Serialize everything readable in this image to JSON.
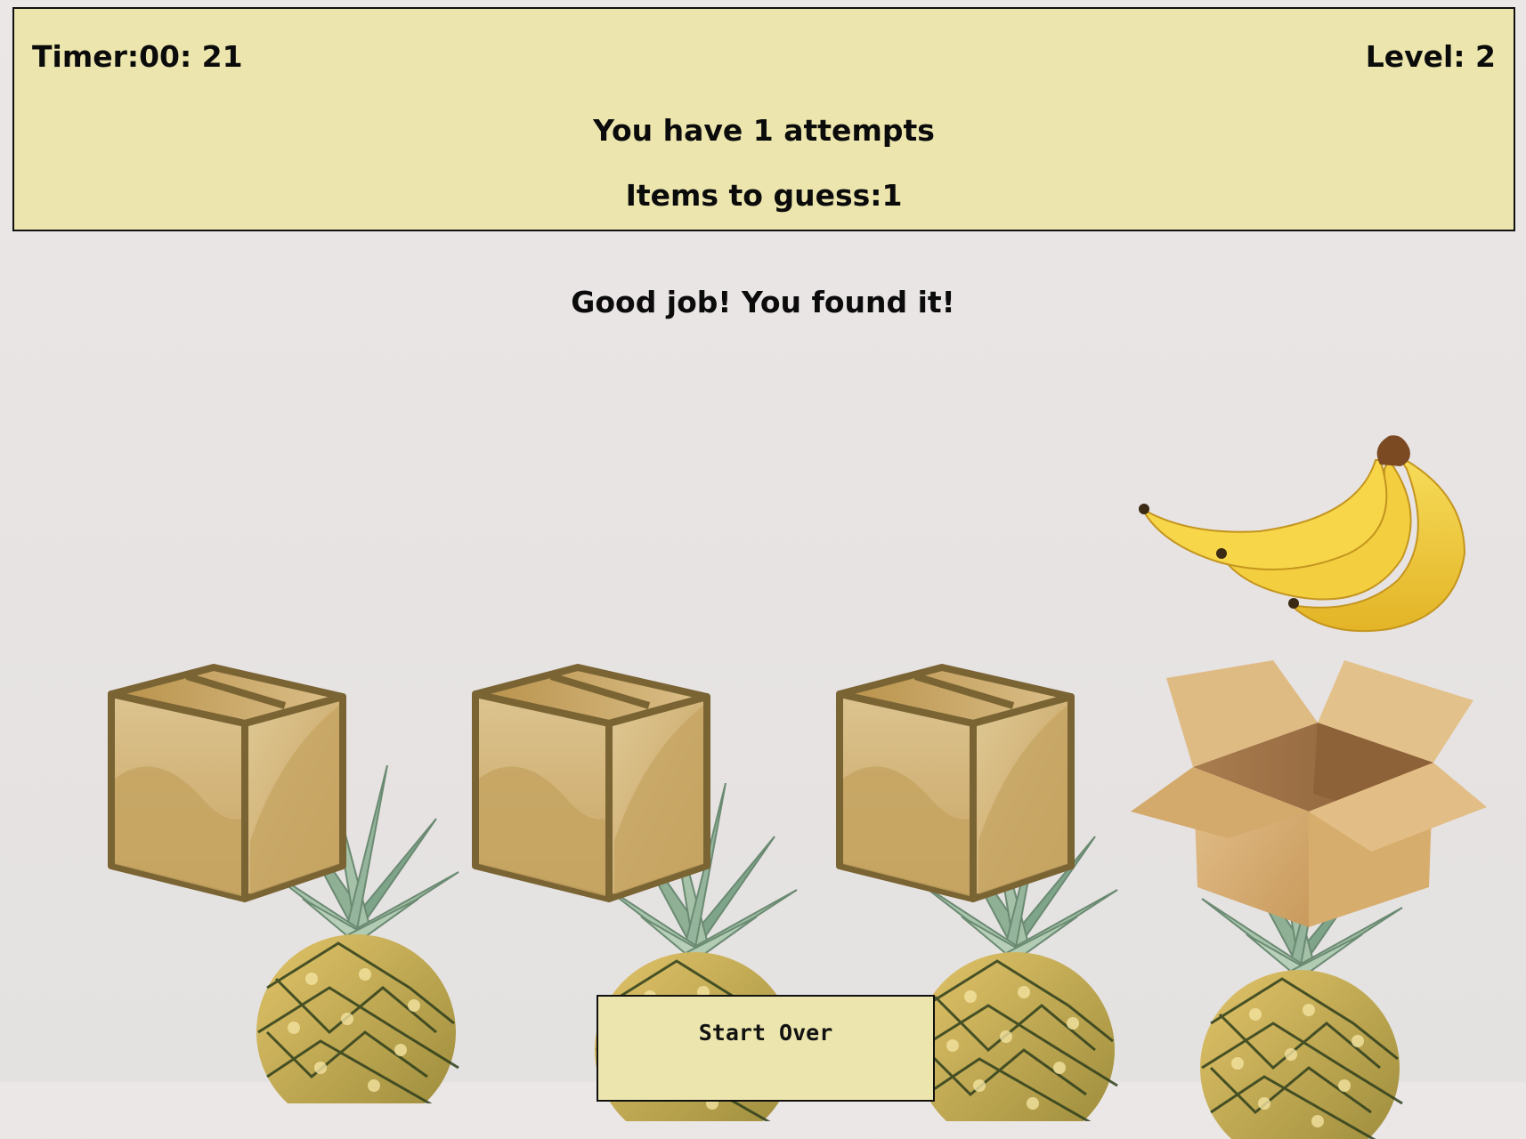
{
  "hud": {
    "timer_label": "Timer:",
    "timer_value": "00: 21",
    "level_label": "Level:",
    "level_value": "2",
    "attempts_text": "You have 1 attempts",
    "items_label": "Items to guess:",
    "items_value": "1"
  },
  "message": "Good job! You found it!",
  "boxes": [
    {
      "state": "closed",
      "icon": "closed-box-icon"
    },
    {
      "state": "closed",
      "icon": "closed-box-icon"
    },
    {
      "state": "closed",
      "icon": "closed-box-icon"
    },
    {
      "state": "open",
      "icon": "open-box-icon",
      "revealed_item": "banana-icon"
    }
  ],
  "background_icon": "pineapple-icon",
  "start_over_label": "Start Over",
  "colors": {
    "panel": "#ece6ae",
    "background": "#e8e4e3",
    "box": "#c9a663",
    "box_outline": "#7a6434",
    "banana": "#f2cf3a"
  }
}
